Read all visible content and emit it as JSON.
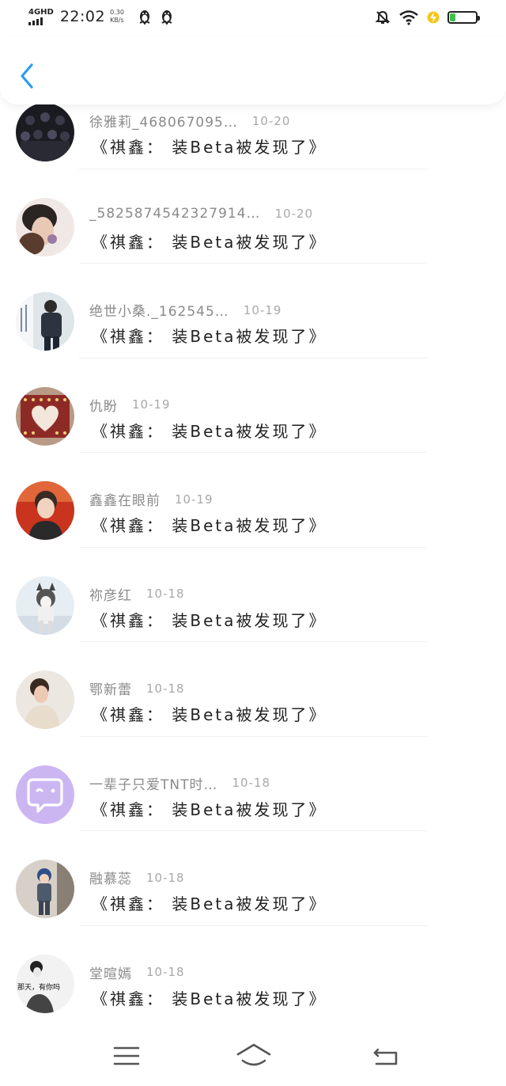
{
  "status_bar": {
    "network": "4GHD",
    "time": "22:02",
    "speed_value": "0.30",
    "speed_unit": "KB/s",
    "battery": "21",
    "battery_level": 0.21,
    "battery_color": "#3cc24a"
  },
  "header": {
    "back_icon": "chevron-left-icon",
    "accent": "#2f9bf0"
  },
  "posts": [
    {
      "nickname": "徐雅莉_468067095…",
      "date": "10-20",
      "title": "《祺鑫： 装Beta被发现了》",
      "avatar": "group-photo"
    },
    {
      "nickname": "_5825874542327914…",
      "date": "10-20",
      "title": "《祺鑫： 装Beta被发现了》",
      "avatar": "couple-photo"
    },
    {
      "nickname": "绝世小桑._162545…",
      "date": "10-19",
      "title": "《祺鑫： 装Beta被发现了》",
      "avatar": "man-standing"
    },
    {
      "nickname": "仇盼",
      "date": "10-19",
      "title": "《祺鑫： 装Beta被发现了》",
      "avatar": "heart-candles"
    },
    {
      "nickname": "鑫鑫在眼前",
      "date": "10-19",
      "title": "《祺鑫： 装Beta被发现了》",
      "avatar": "boy-portrait"
    },
    {
      "nickname": "祢彦红",
      "date": "10-18",
      "title": "《祺鑫： 装Beta被发现了》",
      "avatar": "husky-dog"
    },
    {
      "nickname": "鄂新蕾",
      "date": "10-18",
      "title": "《祺鑫： 装Beta被发现了》",
      "avatar": "woman-portrait"
    },
    {
      "nickname": "一辈子只爱TNT时…",
      "date": "10-18",
      "title": "《祺鑫： 装Beta被发现了》",
      "avatar": "default-chat-avatar"
    },
    {
      "nickname": "融慕蕊",
      "date": "10-18",
      "title": "《祺鑫： 装Beta被发现了》",
      "avatar": "child-photo"
    },
    {
      "nickname": "堂暄嫣",
      "date": "10-18",
      "title": "《祺鑫： 装Beta被发现了》",
      "avatar": "sketch-girl",
      "avatar_text": "那天，有你吗"
    }
  ],
  "nav_bar": {
    "menu_icon": "menu-icon",
    "home_icon": "home-icon",
    "back_icon": "back-icon"
  }
}
